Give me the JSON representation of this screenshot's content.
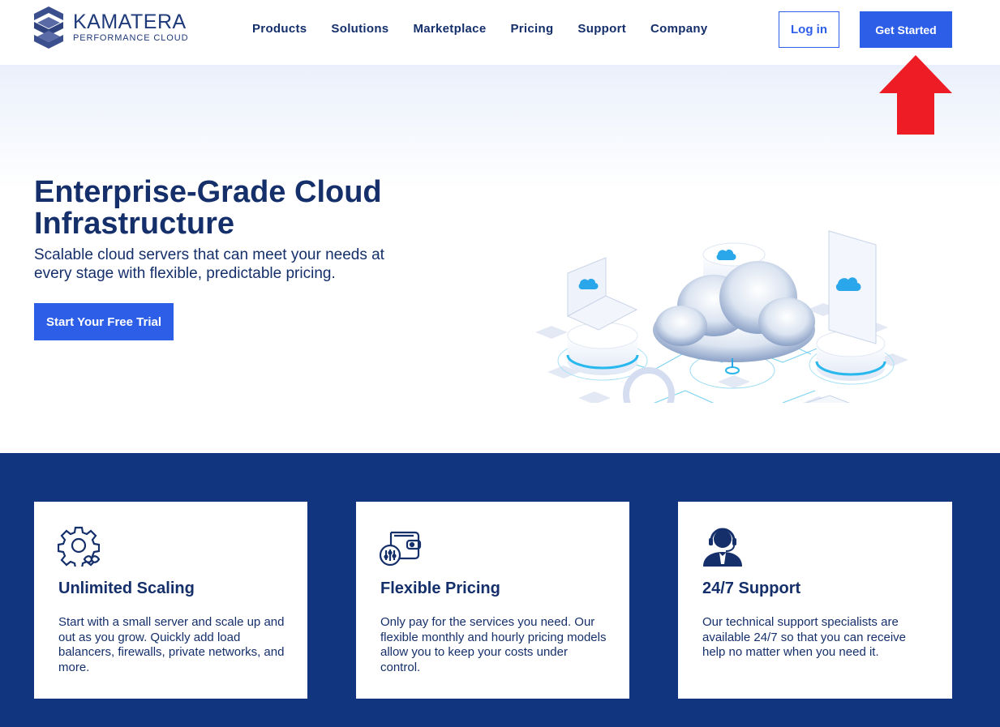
{
  "header": {
    "logo": {
      "name": "KAMATERA",
      "tagline": "PERFORMANCE CLOUD"
    },
    "nav": [
      "Products",
      "Solutions",
      "Marketplace",
      "Pricing",
      "Support",
      "Company"
    ],
    "login_label": "Log in",
    "get_started_label": "Get Started"
  },
  "hero": {
    "title": "Enterprise-Grade Cloud Infrastructure",
    "subtitle": "Scalable cloud servers that can meet your needs at every stage with flexible, predictable pricing.",
    "cta_label": "Start Your Free Trial"
  },
  "features": [
    {
      "icon": "gear-infinity-icon",
      "title": "Unlimited Scaling",
      "text": "Start with a small server and scale up and out as you grow. Quickly add load balancers, firewalls, private networks, and more."
    },
    {
      "icon": "wallet-icon",
      "title": "Flexible Pricing",
      "text": "Only pay for the services you need. Our flexible monthly and hourly pricing models allow you to keep your costs under control."
    },
    {
      "icon": "support-agent-icon",
      "title": "24/7 Support",
      "text": "Our technical support specialists are available 24/7 so that you can receive help no matter when you need it."
    }
  ],
  "colors": {
    "brand_navy": "#11357f",
    "accent_blue": "#2c5ee8",
    "text_navy": "#152f6b",
    "annotation_red": "#ee1c25"
  }
}
